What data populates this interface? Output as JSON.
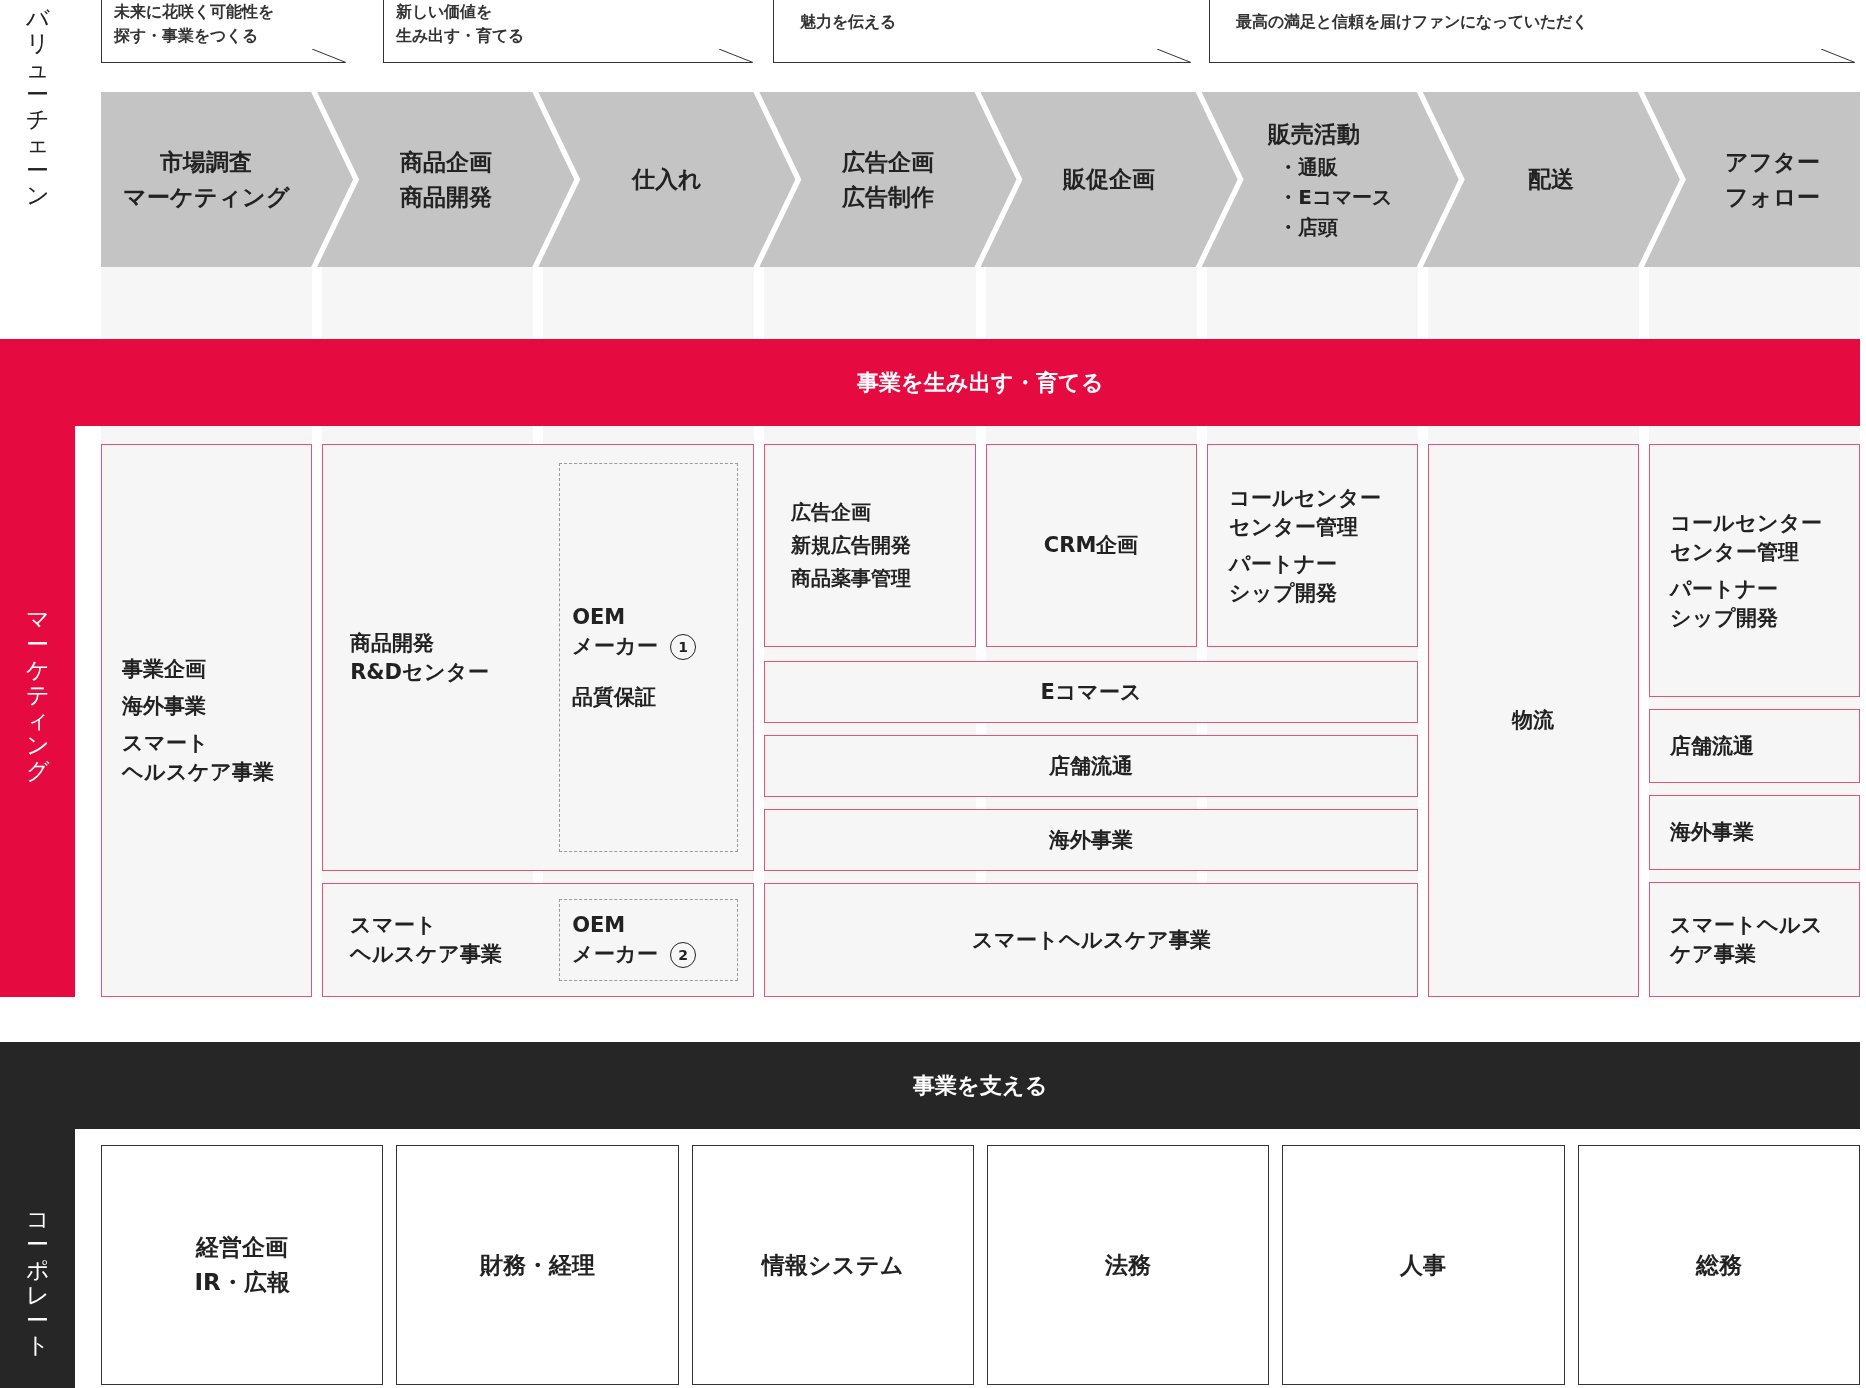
{
  "value_chain": {
    "label": "バリューチェーン",
    "callouts": [
      {
        "lines": [
          "未来に花咲く可能性を",
          "探す・事業をつくる"
        ]
      },
      {
        "lines": [
          "新しい価値を",
          "生み出す・育てる"
        ]
      },
      {
        "lines": [
          "魅力を伝える"
        ]
      },
      {
        "lines": [
          "最高の満足と信頼を届けファンになっていただく"
        ]
      }
    ],
    "steps": [
      {
        "lines": [
          "市場調査",
          "マーケティング"
        ]
      },
      {
        "lines": [
          "商品企画",
          "商品開発"
        ]
      },
      {
        "lines": [
          "仕入れ"
        ]
      },
      {
        "lines": [
          "広告企画",
          "広告制作"
        ]
      },
      {
        "lines": [
          "販促企画"
        ]
      },
      {
        "lines": [
          "販売活動"
        ],
        "bullets": [
          "・通販",
          "・Eコマース",
          "・店頭"
        ]
      },
      {
        "lines": [
          "配送"
        ]
      },
      {
        "lines": [
          "アフター",
          "フォロー"
        ]
      }
    ]
  },
  "marketing": {
    "title": "事業を生み出す・育てる",
    "label": "マーケティング",
    "planning": {
      "groups": [
        [
          "事業企画"
        ],
        [
          "海外事業"
        ],
        [
          "スマート",
          "ヘルスケア事業"
        ]
      ]
    },
    "development": {
      "groups": [
        [
          "商品開発",
          "R&Dセンター"
        ]
      ],
      "oem": {
        "lines": [
          "OEM",
          "メーカー"
        ],
        "number": "1"
      },
      "note": "品質保証"
    },
    "healthcare_development": {
      "groups": [
        [
          "スマート",
          "ヘルスケア事業"
        ]
      ],
      "oem": {
        "lines": [
          "OEM",
          "メーカー"
        ],
        "number": "2"
      }
    },
    "sales_units": [
      {
        "groups": [
          [
            "広告企画",
            "新規広告開発",
            "商品薬事管理"
          ]
        ]
      },
      {
        "groups": [
          [
            "CRM企画"
          ]
        ]
      },
      {
        "groups": [
          [
            "コールセンター",
            "センター管理"
          ],
          [
            "パートナー",
            "シップ開発"
          ]
        ]
      }
    ],
    "sales_rows": [
      "Eコマース",
      "店舗流通",
      "海外事業",
      "スマートヘルスケア事業"
    ],
    "logistics": "物流",
    "aftercare": [
      {
        "groups": [
          [
            "コールセンター",
            "センター管理"
          ],
          [
            "パートナー",
            "シップ開発"
          ]
        ]
      },
      {
        "groups": [
          [
            "店舗流通"
          ]
        ]
      },
      {
        "groups": [
          [
            "海外事業"
          ]
        ]
      },
      {
        "groups": [
          [
            "スマートヘルス",
            "ケア事業"
          ]
        ]
      }
    ]
  },
  "corporate": {
    "title": "事業を支える",
    "label": "コーポレート",
    "departments": [
      [
        "経営企画",
        "IR・広報"
      ],
      [
        "財務・経理"
      ],
      [
        "情報システム"
      ],
      [
        "法務"
      ],
      [
        "人事"
      ],
      [
        "総務"
      ]
    ]
  }
}
